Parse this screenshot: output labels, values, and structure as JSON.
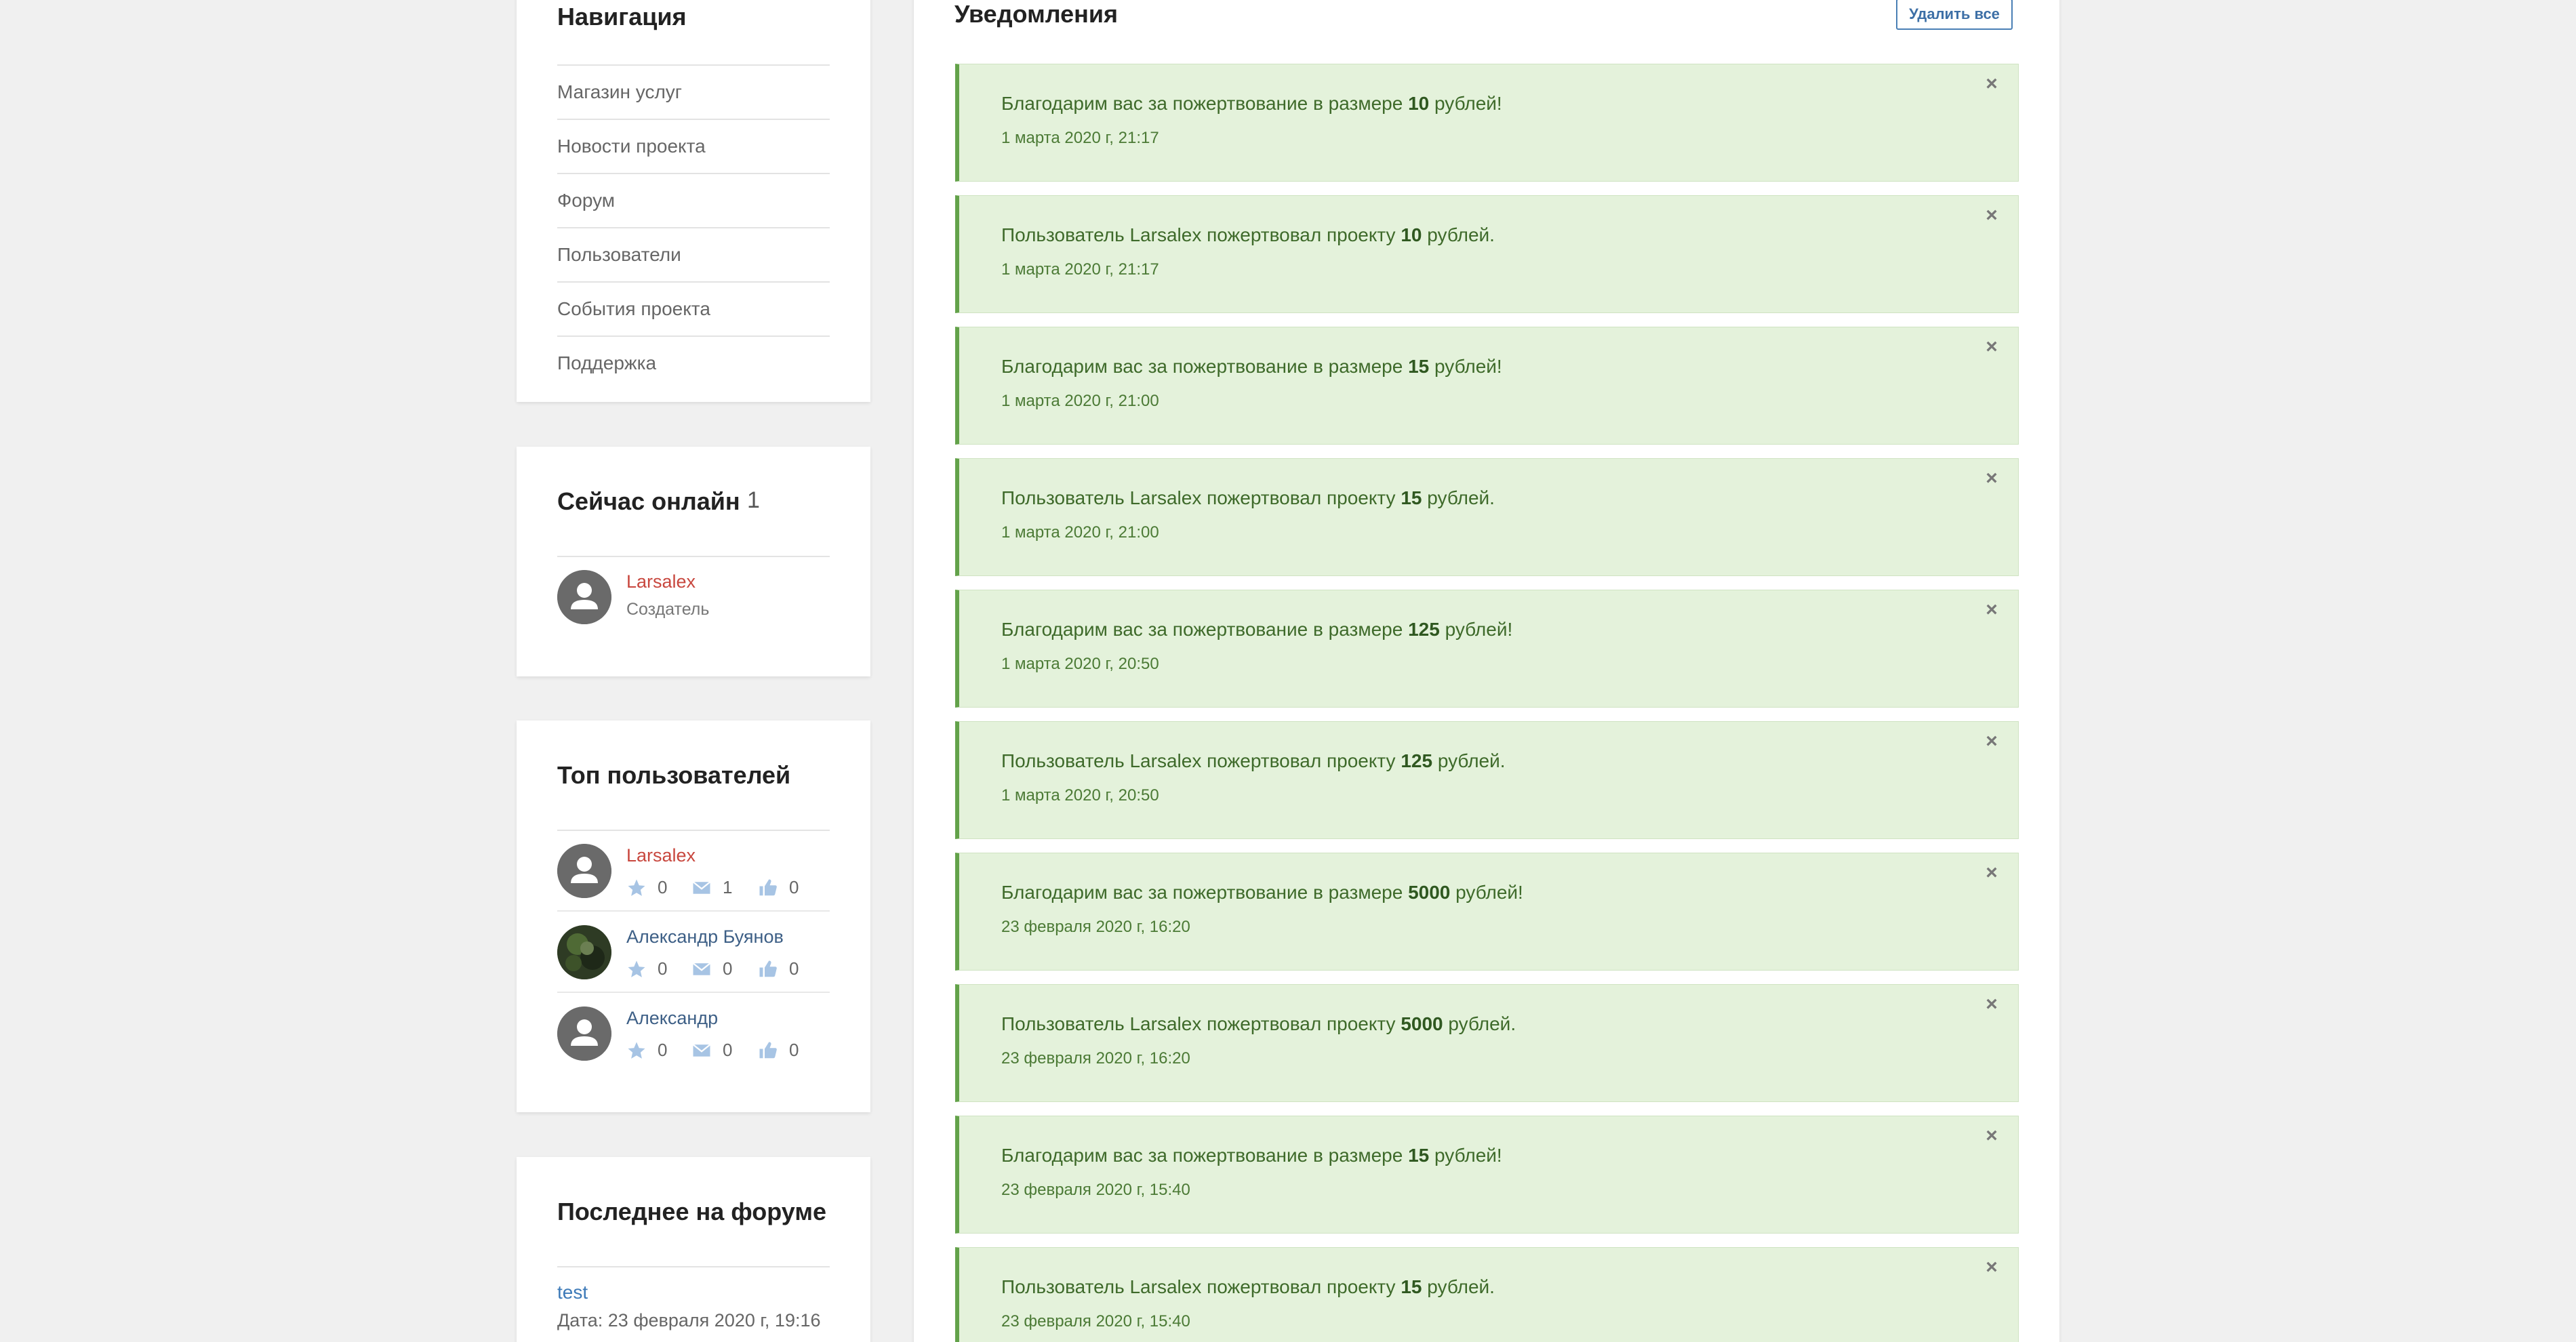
{
  "nav": {
    "title": "Навигация",
    "items": [
      "Магазин услуг",
      "Новости проекта",
      "Форум",
      "Пользователи",
      "События проекта",
      "Поддержка"
    ]
  },
  "online": {
    "title": "Сейчас онлайн",
    "count": "1",
    "user": {
      "name": "Larsalex",
      "role": "Создатель"
    }
  },
  "top_users": {
    "title": "Топ пользователей",
    "users": [
      {
        "name": "Larsalex",
        "stars": "0",
        "messages": "1",
        "likes": "0"
      },
      {
        "name": "Александр Буянов",
        "stars": "0",
        "messages": "0",
        "likes": "0"
      },
      {
        "name": "Александр",
        "stars": "0",
        "messages": "0",
        "likes": "0"
      }
    ]
  },
  "forum": {
    "title": "Последнее на форуме",
    "topic": "test",
    "date": "Дата: 23 февраля 2020 г, 19:16"
  },
  "notifications": {
    "title": "Уведомления",
    "delete_all": "Удалить все",
    "close_glyph": "×",
    "items": [
      {
        "prefix": "Благодарим вас за пожертвование в размере ",
        "amount": "10",
        "suffix": " рублей!",
        "time": "1 марта 2020 г, 21:17"
      },
      {
        "prefix": "Пользователь Larsalex пожертвовал проекту ",
        "amount": "10",
        "suffix": " рублей.",
        "time": "1 марта 2020 г, 21:17"
      },
      {
        "prefix": "Благодарим вас за пожертвование в размере ",
        "amount": "15",
        "suffix": " рублей!",
        "time": "1 марта 2020 г, 21:00"
      },
      {
        "prefix": "Пользователь Larsalex пожертвовал проекту ",
        "amount": "15",
        "suffix": " рублей.",
        "time": "1 марта 2020 г, 21:00"
      },
      {
        "prefix": "Благодарим вас за пожертвование в размере ",
        "amount": "125",
        "suffix": " рублей!",
        "time": "1 марта 2020 г, 20:50"
      },
      {
        "prefix": "Пользователь Larsalex пожертвовал проекту ",
        "amount": "125",
        "suffix": " рублей.",
        "time": "1 марта 2020 г, 20:50"
      },
      {
        "prefix": "Благодарим вас за пожертвование в размере ",
        "amount": "5000",
        "suffix": " рублей!",
        "time": "23 февраля 2020 г, 16:20"
      },
      {
        "prefix": "Пользователь Larsalex пожертвовал проекту ",
        "amount": "5000",
        "suffix": " рублей.",
        "time": "23 февраля 2020 г, 16:20"
      },
      {
        "prefix": "Благодарим вас за пожертвование в размере ",
        "amount": "15",
        "suffix": " рублей!",
        "time": "23 февраля 2020 г, 15:40"
      },
      {
        "prefix": "Пользователь Larsalex пожертвовал проекту ",
        "amount": "15",
        "suffix": " рублей.",
        "time": "23 февраля 2020 г, 15:40"
      }
    ]
  },
  "colors": {
    "background": "#f0f0f0",
    "notice_bg": "#e4f2db",
    "notice_border": "#63a24a",
    "notice_text": "#3e6a2a",
    "creator_name": "#c8473e",
    "user_name": "#3d5f86",
    "icon_blue": "#a7c4e4"
  },
  "icons": {
    "avatar": "default-user-avatar-icon",
    "star": "star-icon",
    "message": "envelope-icon",
    "like": "thumbs-up-icon",
    "close": "close-icon"
  }
}
